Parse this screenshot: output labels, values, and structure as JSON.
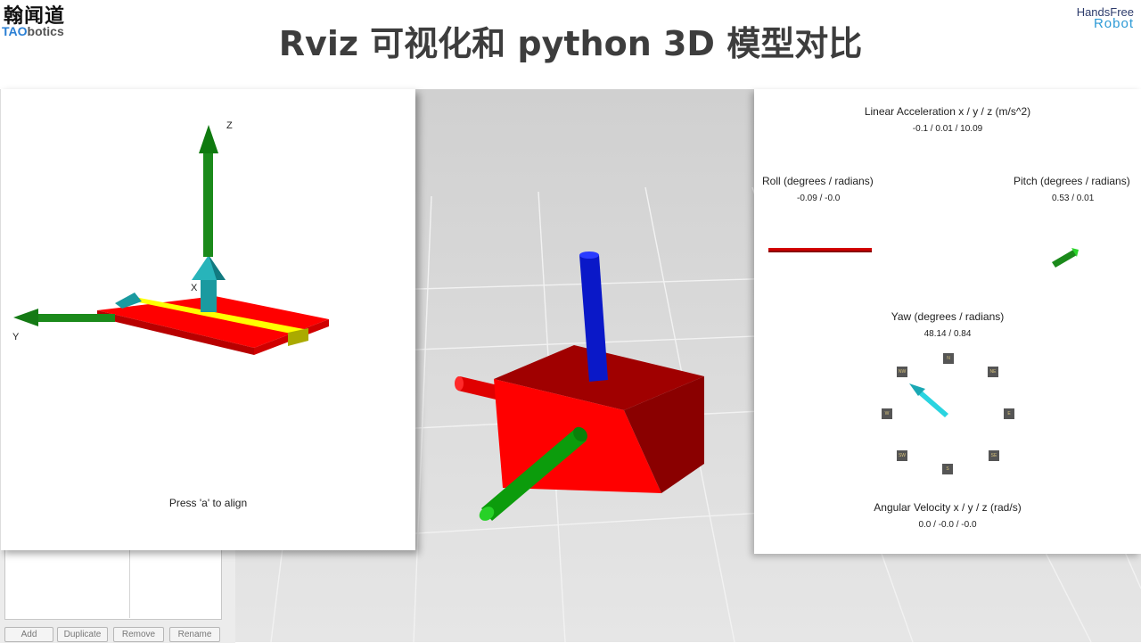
{
  "header": {
    "logo_cn": "翰闻道",
    "logo_en_accent": "TAO",
    "logo_en_rest": "botics",
    "title": "Rviz 可视化和 python 3D 模型对比",
    "brand_line1": "HandsFree",
    "brand_line2": "Robot"
  },
  "rviz_panel": {
    "buttons": [
      "Add",
      "Duplicate",
      "Remove",
      "Rename"
    ]
  },
  "axes_view": {
    "z_label": "Z",
    "x_label": "X",
    "y_label": "Y",
    "hint": "Press 'a' to align"
  },
  "imu_view": {
    "linear_accel_label": "Linear Acceleration x / y / z (m/s^2)",
    "linear_accel_value": "-0.1 / 0.01 / 10.09",
    "roll_label": "Roll (degrees / radians)",
    "roll_value": "-0.09 / -0.0",
    "pitch_label": "Pitch (degrees / radians)",
    "pitch_value": "0.53 / 0.01",
    "yaw_label": "Yaw (degrees / radians)",
    "yaw_value": "48.14 / 0.84",
    "angular_vel_label": "Angular Velocity x / y / z (rad/s)",
    "angular_vel_value": "0.0 / -0.0 / -0.0",
    "compass": [
      "N",
      "NE",
      "E",
      "SE",
      "S",
      "SW",
      "W",
      "NW"
    ]
  },
  "colors": {
    "red": "#ff0000",
    "dark_red": "#8a0000",
    "green": "#1b8a1b",
    "blue": "#0a18c8",
    "teal": "#1a9aa0",
    "yellow": "#ffff00",
    "cyan": "#2ad4e0",
    "title_gray": "#3d3d3d"
  }
}
